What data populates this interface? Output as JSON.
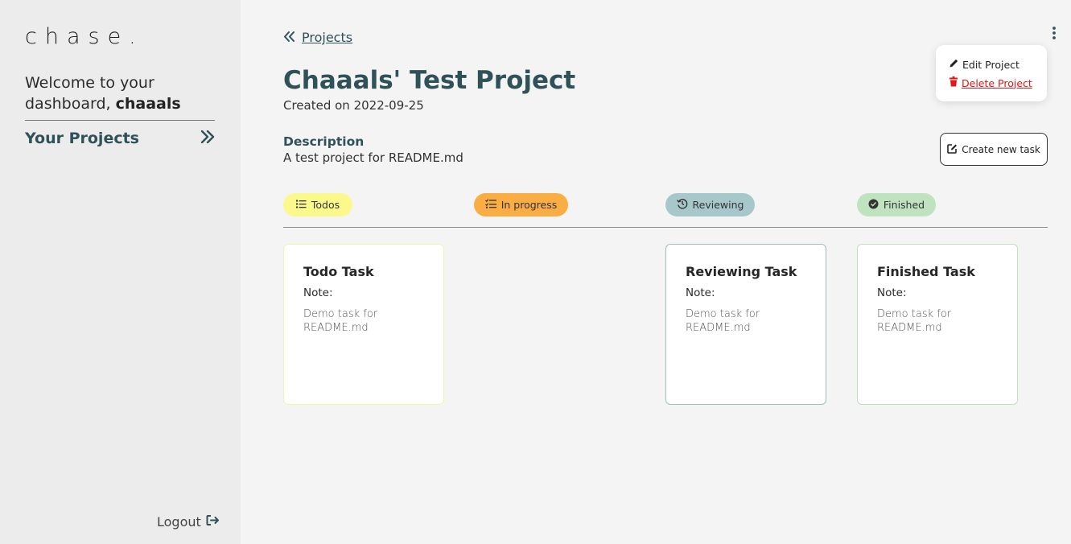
{
  "sidebar": {
    "brand": "chase.",
    "welcome_prefix": "Welcome to your dashboard,",
    "username": "chaaals",
    "your_projects_label": "Your Projects",
    "logout_label": "Logout"
  },
  "header": {
    "breadcrumb_label": "Projects",
    "title": "Chaaals' Test Project",
    "created": "Created on 2022-09-25",
    "description_label": "Description",
    "description": "A test project for README.md",
    "create_task_label": "Create new task"
  },
  "menu": {
    "edit_label": "Edit Project",
    "delete_label": "Delete Project"
  },
  "columns": [
    {
      "label": "Todos",
      "color": "#fbf98c",
      "icon": "list-icon"
    },
    {
      "label": "In progress",
      "color": "#f9ad43",
      "icon": "checklist-icon"
    },
    {
      "label": "Reviewing",
      "color": "#a7c8cb",
      "icon": "history-icon"
    },
    {
      "label": "Finished",
      "color": "#bfe2bf",
      "icon": "check-circle-icon"
    }
  ],
  "cards": [
    {
      "title": "Todo Task",
      "note_label": "Note:",
      "note": "Demo task for README.md"
    },
    {
      "title": "Reviewing Task",
      "note_label": "Note:",
      "note": "Demo task for README.md"
    },
    {
      "title": "Finished Task",
      "note_label": "Note:",
      "note": "Demo task for README.md"
    }
  ]
}
